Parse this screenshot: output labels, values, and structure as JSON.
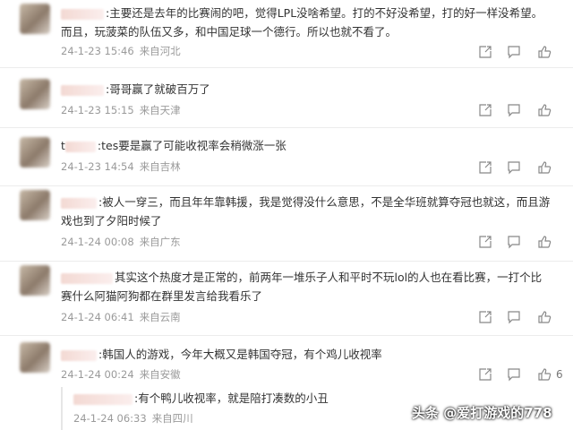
{
  "comments": [
    {
      "text": ":主要还是去年的比赛闹的吧，觉得LPL没啥希望。打的不好没希望，打的好一样没希望。而且，玩菠菜的队伍又多，和中国足球一个德行。所以也就不看了。",
      "date": "24-1-23 15:46",
      "location": "来自河北",
      "likes": ""
    },
    {
      "text": ":哥哥赢了就破百万了",
      "date": "24-1-23 15:15",
      "location": "来自天津",
      "likes": ""
    },
    {
      "prefix": "t",
      "text": ":tes要是赢了可能收视率会稍微涨一张",
      "date": "24-1-23 14:54",
      "location": "来自吉林",
      "likes": ""
    },
    {
      "text": ":被人一穿三，而且年年靠韩援，我是觉得没什么意思，不是全华班就算夺冠也就这，而且游戏也到了夕阳时候了",
      "date": "24-1-24 00:08",
      "location": "来自广东",
      "likes": ""
    },
    {
      "text": "其实这个热度才是正常的，前两年一堆乐子人和平时不玩lol的人也在看比赛，一打个比赛什么阿猫阿狗都在群里发言给我看乐了",
      "date": "24-1-24 06:41",
      "location": "来自云南",
      "likes": ""
    },
    {
      "text": ":韩国人的游戏，今年大概又是韩国夺冠，有个鸡儿收视率",
      "date": "24-1-24 00:24",
      "location": "来自安徽",
      "likes": "6"
    }
  ],
  "reply": {
    "text": ":有个鸭儿收视率，就是陪打凑数的小丑",
    "date": "24-1-24 06:33",
    "location": "来自四川"
  },
  "watermark": "头条 @爱打游戏的778",
  "icons": [
    "share-icon",
    "comment-icon",
    "like-icon"
  ]
}
